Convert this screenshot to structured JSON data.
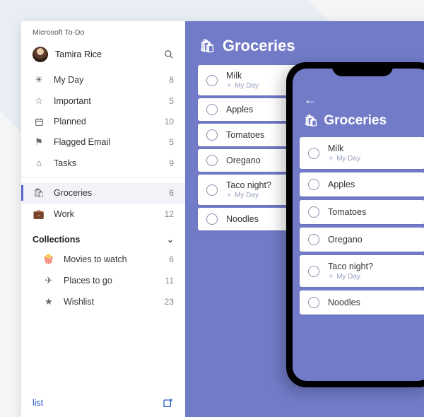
{
  "app_title": "Microsoft To-Do",
  "user": {
    "name": "Tamira Rice"
  },
  "smartLists": [
    {
      "label": "My Day",
      "count": 8
    },
    {
      "label": "Important",
      "count": 5
    },
    {
      "label": "Planned",
      "count": 10
    },
    {
      "label": "Flagged Email",
      "count": 5
    },
    {
      "label": "Tasks",
      "count": 9
    }
  ],
  "userLists": [
    {
      "label": "Groceries",
      "count": 6,
      "active": true
    },
    {
      "label": "Work",
      "count": 12
    }
  ],
  "collections": {
    "header": "Collections",
    "items": [
      {
        "label": "Movies to watch",
        "count": 6
      },
      {
        "label": "Places to go",
        "count": 11
      },
      {
        "label": "Wishlist",
        "count": 23
      }
    ]
  },
  "newListLabel": "list",
  "currentList": {
    "title": "Groceries",
    "tasks": [
      {
        "label": "Milk",
        "tag": "My Day"
      },
      {
        "label": "Apples"
      },
      {
        "label": "Tomatoes"
      },
      {
        "label": "Oregano"
      },
      {
        "label": "Taco night?",
        "tag": "My Day"
      },
      {
        "label": "Noodles"
      }
    ]
  },
  "phone": {
    "title": "Groceries",
    "tasks": [
      {
        "label": "Milk",
        "tag": "My Day"
      },
      {
        "label": "Apples"
      },
      {
        "label": "Tomatoes"
      },
      {
        "label": "Oregano"
      },
      {
        "label": "Taco night?",
        "tag": "My Day"
      },
      {
        "label": "Noodles"
      }
    ]
  },
  "colors": {
    "accent": "#717bc8"
  }
}
